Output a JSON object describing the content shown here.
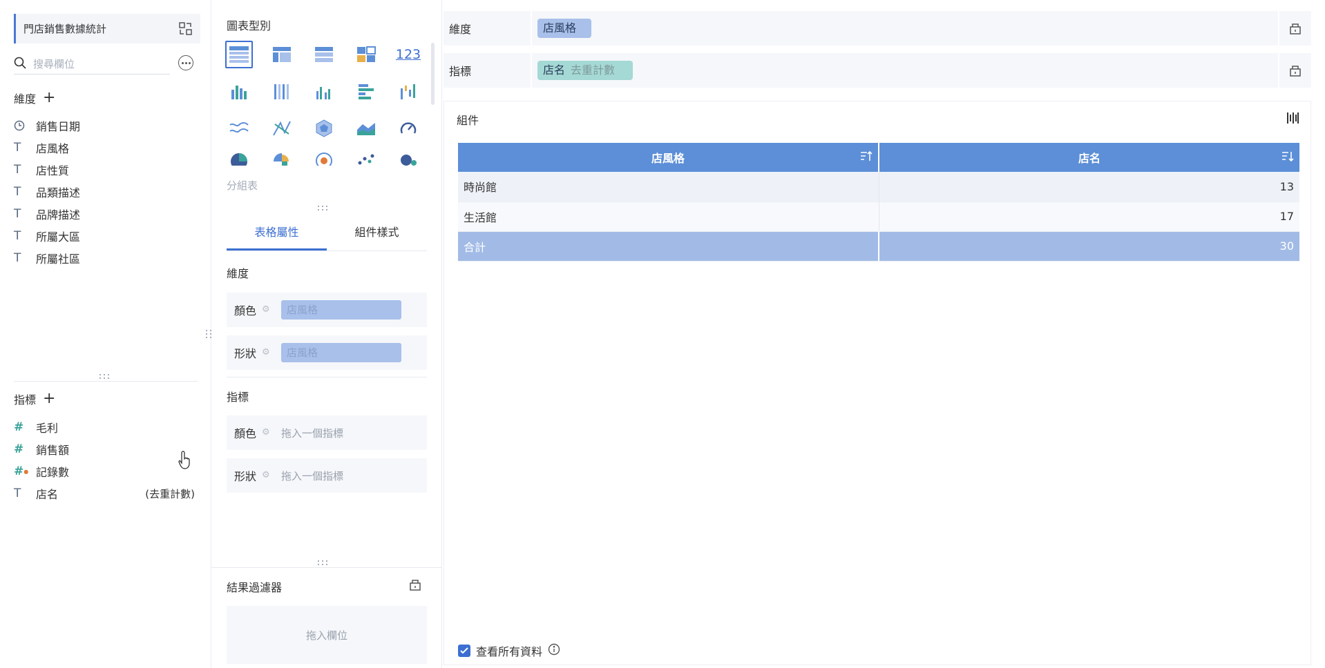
{
  "dataset": {
    "title": "門店銷售數據統計"
  },
  "search": {
    "placeholder": "搜尋欄位"
  },
  "dimensions": {
    "heading": "維度",
    "items": [
      {
        "label": "銷售日期",
        "type": "date"
      },
      {
        "label": "店風格",
        "type": "text"
      },
      {
        "label": "店性質",
        "type": "text"
      },
      {
        "label": "品類描述",
        "type": "text"
      },
      {
        "label": "品牌描述",
        "type": "text"
      },
      {
        "label": "所屬大區",
        "type": "text"
      },
      {
        "label": "所屬社區",
        "type": "text"
      }
    ]
  },
  "metrics": {
    "heading": "指標",
    "items": [
      {
        "label": "毛利",
        "type": "number"
      },
      {
        "label": "銷售額",
        "type": "number"
      },
      {
        "label": "記錄數",
        "type": "number"
      },
      {
        "label": "店名",
        "type": "text",
        "suffix": "(去重計數)"
      }
    ]
  },
  "chart_types": {
    "heading": "圖表型別",
    "group_label": "分組表",
    "text_icon": "123",
    "selected": "grouped-table"
  },
  "tabs": {
    "table_props": "表格屬性",
    "component_style": "組件樣式"
  },
  "props": {
    "dim_heading": "維度",
    "color_label": "顏色",
    "shape_label": "形狀",
    "dim_color_value": "店風格",
    "dim_shape_value": "店風格",
    "met_heading": "指標",
    "met_color_hint": "拖入一個指標",
    "met_shape_hint": "拖入一個指標"
  },
  "result_filter": {
    "heading": "結果過濾器",
    "hint": "拖入欄位"
  },
  "shelves": {
    "dim_label": "維度",
    "dim_value": "店風格",
    "met_label": "指標",
    "met_value": "店名",
    "met_agg": "去重計數"
  },
  "component": {
    "title": "組件",
    "table": {
      "headers": [
        "店風格",
        "店名"
      ],
      "rows": [
        [
          "時尚館",
          "13"
        ],
        [
          "生活館",
          "17"
        ]
      ],
      "total": [
        "合計",
        "30"
      ]
    },
    "view_all_label": "查看所有資料"
  },
  "colors": {
    "accent": "#3c6fd1",
    "header_blue": "#5c8fd7",
    "dimension_pill": "#a8c0ea",
    "metric_pill": "#a5d9d5",
    "metric_icon": "#3aa39a"
  }
}
